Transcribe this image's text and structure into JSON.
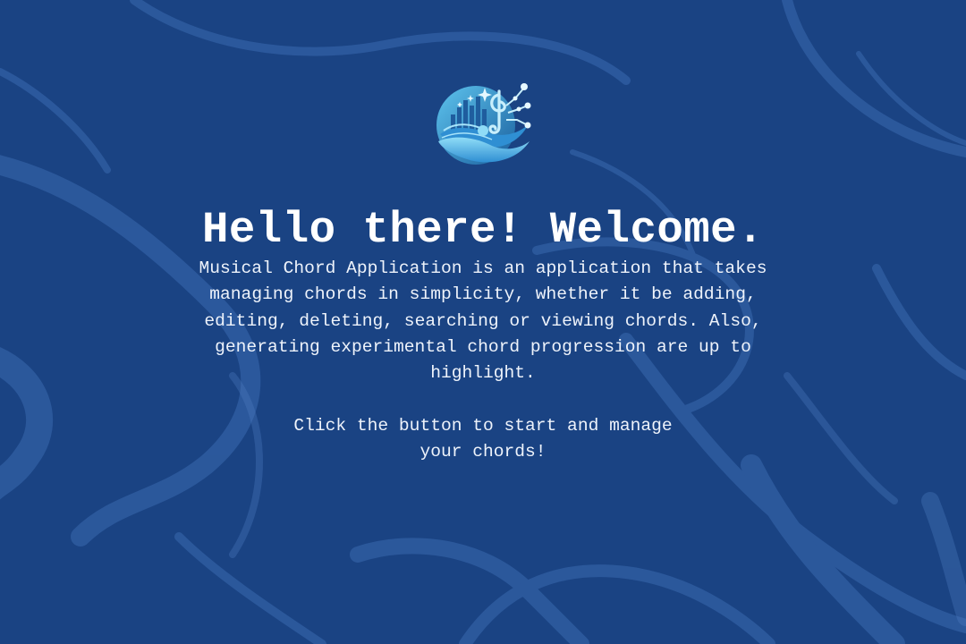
{
  "logo": {
    "icon": "music-note-tech-icon",
    "colors": {
      "primary": "#5ec4ee",
      "secondary": "#2f8fd3",
      "dark": "#1a5f9d"
    }
  },
  "welcome": {
    "title": "Hello there! Welcome.",
    "description": "Musical Chord Application is an application that takes\nmanaging chords in simplicity, whether it be adding,\nediting, deleting, searching or viewing chords. Also,\ngenerating experimental chord progression are up to\nhighlight.",
    "call_to_action": "Click the button to start and manage\nyour chords!"
  },
  "theme": {
    "background": "#1a4383",
    "swirl": "#2d5f9f",
    "text": "#ffffff"
  }
}
